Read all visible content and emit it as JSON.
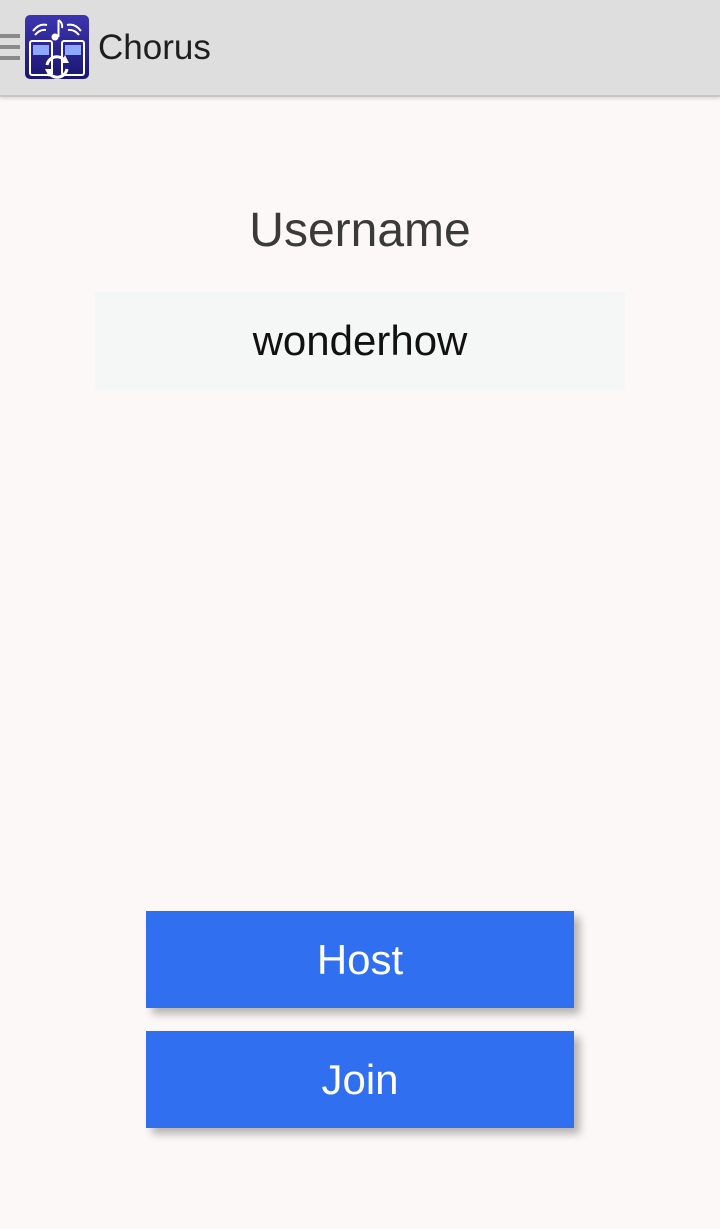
{
  "action_bar": {
    "title": "Chorus",
    "logo_icon": "chorus-app-logo-icon",
    "menu_icon": "hamburger-menu-icon"
  },
  "form": {
    "username_label": "Username",
    "username_value": "wonderhow"
  },
  "buttons": {
    "host_label": "Host",
    "join_label": "Join"
  },
  "colors": {
    "action_bar_bg": "#dedede",
    "page_bg": "#fdf8f8",
    "button_bg": "#2f6ff0",
    "logo_bg": "#2a2490"
  }
}
